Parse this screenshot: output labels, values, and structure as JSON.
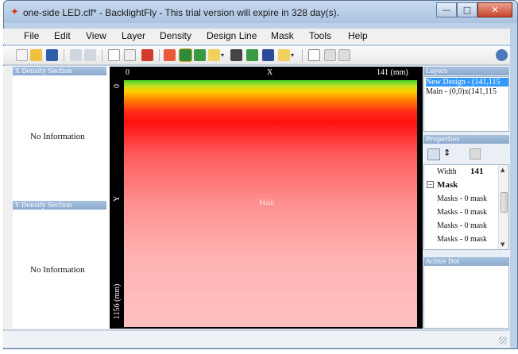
{
  "window": {
    "title": "one-side LED.clf* - BacklightFly - This trial version will expire in 328 day(s).",
    "buttons": {
      "minimize": "—",
      "maximize": "□",
      "close": "✕"
    }
  },
  "menubar": {
    "items": [
      "File",
      "Edit",
      "View",
      "Layer",
      "Density",
      "Design Line",
      "Mask",
      "Tools",
      "Help"
    ]
  },
  "toolbar": {
    "icons": [
      "new-file-icon",
      "open-folder-icon",
      "save-icon",
      "undo-icon",
      "redo-icon",
      "select-icon",
      "zoom-icon",
      "layer-icon",
      "grid-icon",
      "fill-icon",
      "mask-icon",
      "dropdown-icon",
      "export-icon",
      "dot-icon",
      "df-icon",
      "mask-icon-2",
      "dropdown-icon-2",
      "chart-icon",
      "table-icon",
      "list-icon",
      "help-globe-icon"
    ]
  },
  "left": {
    "x_header": "X Density Section",
    "y_header": "Y Density Section",
    "x_info": "No Information",
    "y_info": "No Information"
  },
  "canvas": {
    "origin_label": "0",
    "x_axis_label": "X",
    "x_max_label": "141 (mm)",
    "y_origin_label": "0",
    "y_axis_label": "Y",
    "y_max_label": "1156 (mm)",
    "layer_label": "Main"
  },
  "right": {
    "layers_header": "Layers",
    "layers": [
      {
        "label": "New Design - (141,115",
        "selected": true
      },
      {
        "label": "Main - (0,0)x(141,115",
        "selected": false
      }
    ],
    "properties_header": "Properties",
    "properties": [
      {
        "name": "Width",
        "value": "141"
      },
      {
        "category": "Mask"
      },
      {
        "name": "Masks - 0 mask"
      },
      {
        "name": "Masks - 0 mask"
      },
      {
        "name": "Masks - 0 mask"
      },
      {
        "name": "Masks - 0 mask"
      }
    ],
    "active_dot_header": "Active Dot"
  },
  "colors": {
    "panel_header": "#9db6d6",
    "selection": "#3399ff",
    "canvas_background": "#000000"
  }
}
